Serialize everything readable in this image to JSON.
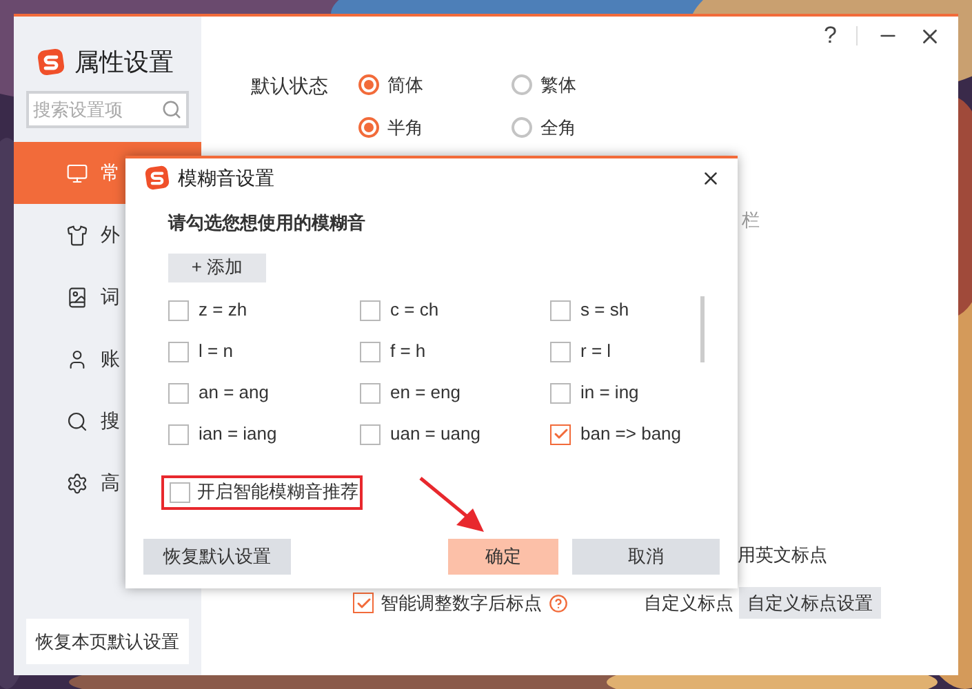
{
  "window": {
    "title": "属性设置",
    "help": "?"
  },
  "sidebar": {
    "search": {
      "placeholder": "搜索设置项"
    },
    "items": [
      {
        "label": "常",
        "selected": true
      },
      {
        "label": "外",
        "selected": false
      },
      {
        "label": "词",
        "selected": false
      },
      {
        "label": "账",
        "selected": false
      },
      {
        "label": "搜",
        "selected": false
      },
      {
        "label": "高",
        "selected": false
      }
    ],
    "reset_button": "恢复本页默认设置"
  },
  "main": {
    "default_state": {
      "label": "默认状态",
      "rows": [
        {
          "options": [
            {
              "label": "简体",
              "selected": true
            },
            {
              "label": "繁体",
              "selected": false
            }
          ]
        },
        {
          "options": [
            {
              "label": "半角",
              "selected": true
            },
            {
              "label": "全角",
              "selected": false
            }
          ]
        }
      ]
    },
    "partial_text": "栏",
    "english_punct": "用英文标点",
    "smart_adjust": {
      "label": "智能调整数字后标点",
      "checked": true
    },
    "custom_label": "自定义标点",
    "custom_button": "自定义标点设置"
  },
  "dialog": {
    "title": "模糊音设置",
    "prompt": "请勾选您想使用的模糊音",
    "add_button": "+ 添加",
    "options": [
      {
        "label": "z = zh",
        "checked": false
      },
      {
        "label": "c = ch",
        "checked": false
      },
      {
        "label": "s = sh",
        "checked": false
      },
      {
        "label": "l = n",
        "checked": false
      },
      {
        "label": "f = h",
        "checked": false
      },
      {
        "label": "r = l",
        "checked": false
      },
      {
        "label": "an = ang",
        "checked": false
      },
      {
        "label": "en = eng",
        "checked": false
      },
      {
        "label": "in = ing",
        "checked": false
      },
      {
        "label": "ian = iang",
        "checked": false
      },
      {
        "label": "uan = uang",
        "checked": false
      },
      {
        "label": "ban => bang",
        "checked": true
      }
    ],
    "smart_recommend": {
      "label": "开启智能模糊音推荐",
      "checked": false
    },
    "buttons": [
      {
        "label": "恢复默认设置",
        "kind": "secondary"
      },
      {
        "label": "确定",
        "kind": "primary"
      },
      {
        "label": "取消",
        "kind": "secondary"
      }
    ]
  }
}
